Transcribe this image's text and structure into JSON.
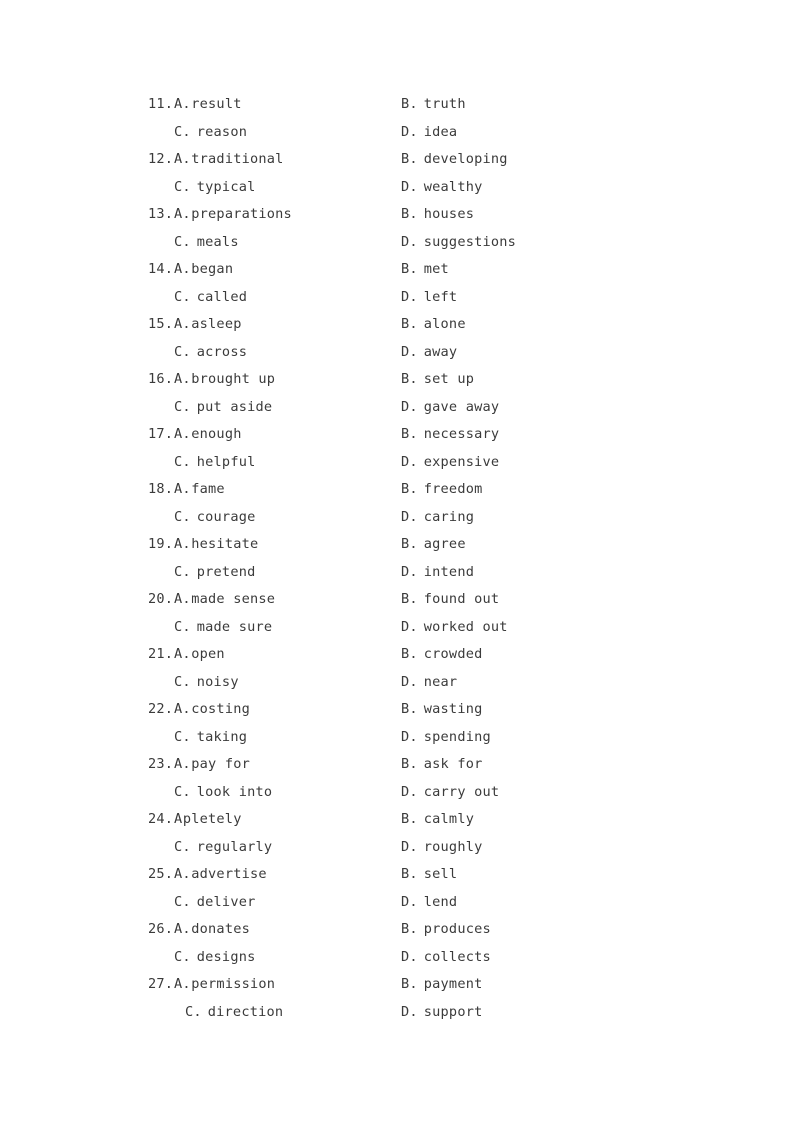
{
  "document": {
    "type": "cloze-test-answer-options",
    "page_background": "#ffffff",
    "text_color": "#3b3b3b",
    "rows": [
      {
        "indented": false,
        "left": {
          "num": "11.",
          "letter": "A.",
          "word": "result",
          "tight": true
        },
        "right": {
          "num": "",
          "letter": "B.",
          "word": "truth",
          "tight": false
        }
      },
      {
        "indented": false,
        "left": {
          "num": "",
          "letter": "C.",
          "word": "reason",
          "tight": false
        },
        "right": {
          "num": "",
          "letter": "D.",
          "word": "idea",
          "tight": false
        }
      },
      {
        "indented": false,
        "left": {
          "num": "12.",
          "letter": "A.",
          "word": "traditional",
          "tight": true
        },
        "right": {
          "num": "",
          "letter": "B.",
          "word": "developing",
          "tight": false
        }
      },
      {
        "indented": false,
        "left": {
          "num": "",
          "letter": "C.",
          "word": "typical",
          "tight": false
        },
        "right": {
          "num": "",
          "letter": "D.",
          "word": "wealthy",
          "tight": false
        }
      },
      {
        "indented": false,
        "left": {
          "num": "13.",
          "letter": "A.",
          "word": "preparations",
          "tight": true
        },
        "right": {
          "num": "",
          "letter": "B.",
          "word": "houses",
          "tight": false
        }
      },
      {
        "indented": false,
        "left": {
          "num": "",
          "letter": "C.",
          "word": "meals",
          "tight": false
        },
        "right": {
          "num": "",
          "letter": "D.",
          "word": "suggestions",
          "tight": false
        }
      },
      {
        "indented": false,
        "left": {
          "num": "14.",
          "letter": "A.",
          "word": "began",
          "tight": true
        },
        "right": {
          "num": "",
          "letter": "B.",
          "word": "met",
          "tight": false
        }
      },
      {
        "indented": false,
        "left": {
          "num": "",
          "letter": "C.",
          "word": "called",
          "tight": false
        },
        "right": {
          "num": "",
          "letter": "D.",
          "word": "left",
          "tight": false
        }
      },
      {
        "indented": false,
        "left": {
          "num": "15.",
          "letter": "A.",
          "word": "asleep",
          "tight": true
        },
        "right": {
          "num": "",
          "letter": "B.",
          "word": "alone",
          "tight": false
        }
      },
      {
        "indented": false,
        "left": {
          "num": "",
          "letter": "C.",
          "word": "across",
          "tight": false
        },
        "right": {
          "num": "",
          "letter": "D.",
          "word": "away",
          "tight": false
        }
      },
      {
        "indented": false,
        "left": {
          "num": "16.",
          "letter": "A.",
          "word": "brought up",
          "tight": true
        },
        "right": {
          "num": "",
          "letter": "B.",
          "word": "set up",
          "tight": false
        }
      },
      {
        "indented": false,
        "left": {
          "num": "",
          "letter": "C.",
          "word": "put aside",
          "tight": false
        },
        "right": {
          "num": "",
          "letter": "D.",
          "word": "gave away",
          "tight": false
        }
      },
      {
        "indented": false,
        "left": {
          "num": "17.",
          "letter": "A.",
          "word": "enough",
          "tight": true
        },
        "right": {
          "num": "",
          "letter": "B.",
          "word": "necessary",
          "tight": false
        }
      },
      {
        "indented": false,
        "left": {
          "num": "",
          "letter": "C.",
          "word": "helpful",
          "tight": false
        },
        "right": {
          "num": "",
          "letter": "D.",
          "word": "expensive",
          "tight": false
        }
      },
      {
        "indented": false,
        "left": {
          "num": "18.",
          "letter": "A.",
          "word": "fame",
          "tight": true
        },
        "right": {
          "num": "",
          "letter": "B.",
          "word": "freedom",
          "tight": false
        }
      },
      {
        "indented": false,
        "left": {
          "num": "",
          "letter": "C.",
          "word": "courage",
          "tight": false
        },
        "right": {
          "num": "",
          "letter": "D.",
          "word": "caring",
          "tight": false
        }
      },
      {
        "indented": false,
        "left": {
          "num": "19.",
          "letter": "A.",
          "word": "hesitate",
          "tight": true
        },
        "right": {
          "num": "",
          "letter": "B.",
          "word": "agree",
          "tight": false
        }
      },
      {
        "indented": false,
        "left": {
          "num": "",
          "letter": "C.",
          "word": "pretend",
          "tight": false
        },
        "right": {
          "num": "",
          "letter": "D.",
          "word": "intend",
          "tight": false
        }
      },
      {
        "indented": false,
        "left": {
          "num": "20.",
          "letter": "A.",
          "word": "made sense",
          "tight": true
        },
        "right": {
          "num": "",
          "letter": "B.",
          "word": "found out",
          "tight": false
        }
      },
      {
        "indented": false,
        "left": {
          "num": "",
          "letter": "C.",
          "word": "made sure",
          "tight": false
        },
        "right": {
          "num": "",
          "letter": "D.",
          "word": "worked out",
          "tight": false
        }
      },
      {
        "indented": false,
        "left": {
          "num": "21.",
          "letter": "A.",
          "word": "open",
          "tight": true
        },
        "right": {
          "num": "",
          "letter": "B.",
          "word": "crowded",
          "tight": false
        }
      },
      {
        "indented": false,
        "left": {
          "num": "",
          "letter": "C.",
          "word": "noisy",
          "tight": false
        },
        "right": {
          "num": "",
          "letter": "D.",
          "word": "near",
          "tight": false
        }
      },
      {
        "indented": false,
        "left": {
          "num": "22.",
          "letter": "A.",
          "word": "costing",
          "tight": true
        },
        "right": {
          "num": "",
          "letter": "B.",
          "word": "wasting",
          "tight": false
        }
      },
      {
        "indented": false,
        "left": {
          "num": "",
          "letter": "C.",
          "word": "taking",
          "tight": false
        },
        "right": {
          "num": "",
          "letter": "D.",
          "word": "spending",
          "tight": false
        }
      },
      {
        "indented": false,
        "left": {
          "num": "23.",
          "letter": "A.",
          "word": "pay for",
          "tight": true
        },
        "right": {
          "num": "",
          "letter": "B.",
          "word": "ask for",
          "tight": false
        }
      },
      {
        "indented": false,
        "left": {
          "num": "",
          "letter": "C.",
          "word": "look into",
          "tight": false
        },
        "right": {
          "num": "",
          "letter": "D.",
          "word": "carry out",
          "tight": false
        }
      },
      {
        "indented": false,
        "left": {
          "num": "24.",
          "letter": "A",
          "word": "pletely",
          "tight": true
        },
        "right": {
          "num": "",
          "letter": "B.",
          "word": "calmly",
          "tight": false
        }
      },
      {
        "indented": false,
        "left": {
          "num": "",
          "letter": "C.",
          "word": "regularly",
          "tight": false
        },
        "right": {
          "num": "",
          "letter": "D.",
          "word": "roughly",
          "tight": false
        }
      },
      {
        "indented": false,
        "left": {
          "num": "25.",
          "letter": "A.",
          "word": "advertise",
          "tight": true
        },
        "right": {
          "num": "",
          "letter": "B.",
          "word": "sell",
          "tight": false
        }
      },
      {
        "indented": false,
        "left": {
          "num": "",
          "letter": "C.",
          "word": "deliver",
          "tight": false
        },
        "right": {
          "num": "",
          "letter": "D.",
          "word": "lend",
          "tight": false
        }
      },
      {
        "indented": false,
        "left": {
          "num": "26.",
          "letter": "A.",
          "word": "donates",
          "tight": true
        },
        "right": {
          "num": "",
          "letter": "B.",
          "word": "produces",
          "tight": false
        }
      },
      {
        "indented": false,
        "left": {
          "num": "",
          "letter": "C.",
          "word": "designs",
          "tight": false
        },
        "right": {
          "num": "",
          "letter": "D.",
          "word": "collects",
          "tight": false
        }
      },
      {
        "indented": false,
        "left": {
          "num": "27.",
          "letter": "A.",
          "word": "permission",
          "tight": true
        },
        "right": {
          "num": "",
          "letter": "B.",
          "word": "payment",
          "tight": false
        }
      },
      {
        "indented": true,
        "left": {
          "num": "",
          "letter": "C.",
          "word": "direction",
          "tight": false
        },
        "right": {
          "num": "",
          "letter": "D.",
          "word": "support",
          "tight": false
        }
      }
    ]
  }
}
